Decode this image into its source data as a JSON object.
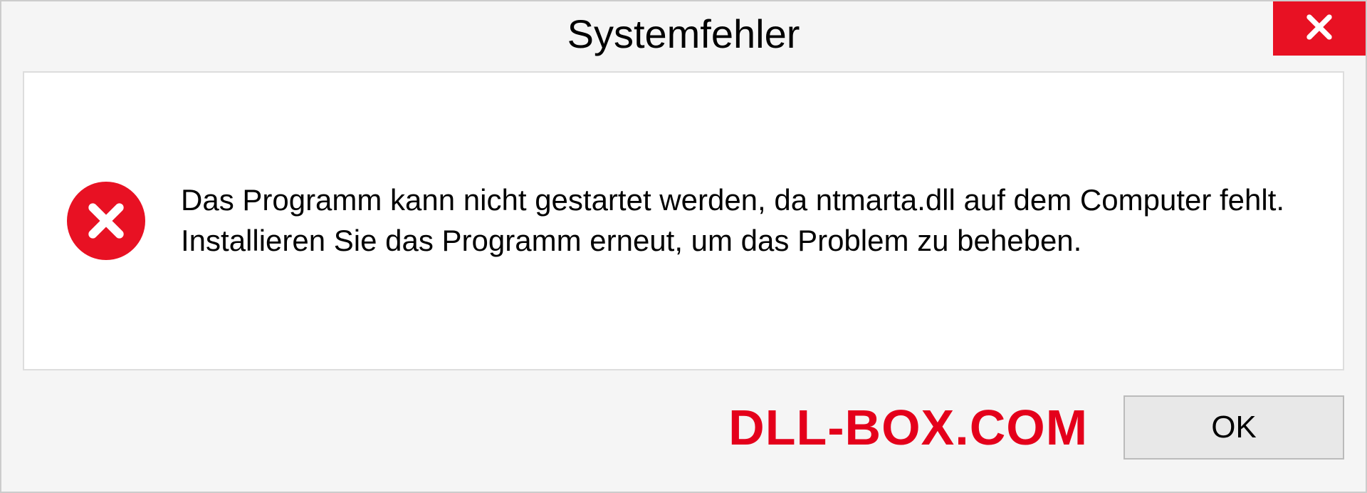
{
  "dialog": {
    "title": "Systemfehler",
    "message": "Das Programm kann nicht gestartet werden, da ntmarta.dll auf dem Computer fehlt. Installieren Sie das Programm erneut, um das Problem zu beheben.",
    "ok_label": "OK",
    "watermark": "DLL-BOX.COM"
  }
}
